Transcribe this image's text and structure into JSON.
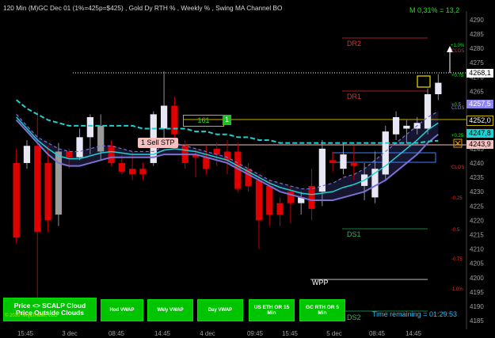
{
  "header": {
    "title": "120 Min  (M)GC Dec 01  (1%=425p=$425) , Gold Dy RTH % , Weekly % , Swing MA Channel BO",
    "momentum": "M 0,31% = 13,2"
  },
  "footer": {
    "time_remaining": "Time remaining = 01:29:53",
    "copyright": "© 2020 NinjaTrader, LLC"
  },
  "buttons": {
    "scalp_cloud": "Price <> SCALP Cloud",
    "price_outside": "Price Outside Clouds",
    "hod_vwap": "Hod VWAP",
    "wkly_vwap": "Wkly VWAP",
    "day_vwap": "Day VWAP",
    "us_eth": "US ETH OR 15 Min",
    "gc_rth": "GC RTH OR 5 Min"
  },
  "annotations": {
    "sell_stop": "1 Sell STP",
    "order_qty": "161",
    "order_count": "1",
    "dr2": "DR2",
    "dr1": "DR1",
    "ds1": "DS1",
    "ds2": "DS2",
    "wpp": "WPP",
    "clos": "CLOS",
    "pct_labels": [
      "+1.0%",
      "+0.75",
      "+0.5",
      "+0.25",
      "-0.25",
      "-0.5",
      "-0.75",
      "-1.0%"
    ]
  },
  "price_labels": {
    "last": "4268,1",
    "ma_upper": "4257,5",
    "order": "4252,0",
    "ma_mid": "4247,8",
    "sell_stop": "4243,9"
  },
  "colors": {
    "up_candle": "#e8e8f4",
    "down_candle": "#e00000",
    "up_grey": "#9a9a9a",
    "ma_cyan": "#20d0d0",
    "ma_purple": "#7a70d0",
    "band_fill": "#1a1a3a",
    "axis_text": "#a0a0a0",
    "button_green": "#00c400"
  },
  "chart_data": {
    "type": "candlestick",
    "title": "120 Min  (M)GC Dec 01  (1%=425p=$425) , Gold Dy RTH % , Weekly % , Swing MA Channel BO",
    "y_ticks": [
      4290,
      4285,
      4280,
      4275,
      4270,
      4265,
      4260,
      4255,
      4250,
      4245,
      4240,
      4235,
      4230,
      4225,
      4220,
      4215,
      4210,
      4205,
      4200,
      4195,
      4190,
      4185
    ],
    "ylim": [
      4182,
      4293
    ],
    "x_ticks": [
      "15:45",
      "3 dec",
      "08:45",
      "14:45",
      "4 dec",
      "09:45",
      "15:45",
      "5 dec",
      "08:45",
      "14:45"
    ],
    "candles": [
      {
        "o": 4240,
        "h": 4245,
        "l": 4212,
        "c": 4214
      },
      {
        "o": 4240,
        "h": 4248,
        "l": 4238,
        "c": 4246
      },
      {
        "o": 4246,
        "h": 4258,
        "l": 4192,
        "c": 4216
      },
      {
        "o": 4240,
        "h": 4246,
        "l": 4216,
        "c": 4220
      },
      {
        "o": 4222,
        "h": 4247,
        "l": 4218,
        "c": 4244
      },
      {
        "o": 4244,
        "h": 4245,
        "l": 4238,
        "c": 4242
      },
      {
        "o": 4242,
        "h": 4252,
        "l": 4241,
        "c": 4249
      },
      {
        "o": 4249,
        "h": 4257,
        "l": 4243,
        "c": 4256
      },
      {
        "o": 4244,
        "h": 4257,
        "l": 4241,
        "c": 4253
      },
      {
        "o": 4246,
        "h": 4248,
        "l": 4239,
        "c": 4240
      },
      {
        "o": 4240,
        "h": 4243,
        "l": 4236,
        "c": 4237
      },
      {
        "o": 4238,
        "h": 4244,
        "l": 4234,
        "c": 4236
      },
      {
        "o": 4238,
        "h": 4240,
        "l": 4234,
        "c": 4236
      },
      {
        "o": 4240,
        "h": 4258,
        "l": 4239,
        "c": 4257
      },
      {
        "o": 4252,
        "h": 4272,
        "l": 4246,
        "c": 4260
      },
      {
        "o": 4260,
        "h": 4263,
        "l": 4248,
        "c": 4250
      },
      {
        "o": 4246,
        "h": 4248,
        "l": 4238,
        "c": 4240
      },
      {
        "o": 4243,
        "h": 4245,
        "l": 4235,
        "c": 4242
      },
      {
        "o": 4242,
        "h": 4246,
        "l": 4236,
        "c": 4238
      },
      {
        "o": 4245,
        "h": 4247,
        "l": 4239,
        "c": 4243
      },
      {
        "o": 4244,
        "h": 4248,
        "l": 4236,
        "c": 4241
      },
      {
        "o": 4244,
        "h": 4247,
        "l": 4230,
        "c": 4231
      },
      {
        "o": 4238,
        "h": 4240,
        "l": 4230,
        "c": 4232
      },
      {
        "o": 4234,
        "h": 4236,
        "l": 4210,
        "c": 4220
      },
      {
        "o": 4232,
        "h": 4234,
        "l": 4218,
        "c": 4222
      },
      {
        "o": 4226,
        "h": 4228,
        "l": 4218,
        "c": 4222
      },
      {
        "o": 4230,
        "h": 4232,
        "l": 4219,
        "c": 4226
      },
      {
        "o": 4226,
        "h": 4230,
        "l": 4222,
        "c": 4228
      },
      {
        "o": 4232,
        "h": 4238,
        "l": 4220,
        "c": 4224
      },
      {
        "o": 4230,
        "h": 4248,
        "l": 4225,
        "c": 4245
      },
      {
        "o": 4241,
        "h": 4244,
        "l": 4237,
        "c": 4240
      },
      {
        "o": 4238,
        "h": 4247,
        "l": 4236,
        "c": 4243
      },
      {
        "o": 4240,
        "h": 4246,
        "l": 4234,
        "c": 4239
      },
      {
        "o": 4232,
        "h": 4240,
        "l": 4227,
        "c": 4236
      },
      {
        "o": 4228,
        "h": 4244,
        "l": 4226,
        "c": 4238
      },
      {
        "o": 4236,
        "h": 4253,
        "l": 4234,
        "c": 4251
      },
      {
        "o": 4250,
        "h": 4258,
        "l": 4248,
        "c": 4256
      },
      {
        "o": 4252,
        "h": 4255,
        "l": 4247,
        "c": 4253
      },
      {
        "o": 4252,
        "h": 4256,
        "l": 4250,
        "c": 4254
      },
      {
        "o": 4252,
        "h": 4266,
        "l": 4250,
        "c": 4264
      },
      {
        "o": 4264,
        "h": 4271,
        "l": 4262,
        "c": 4268
      }
    ],
    "ma_cyan": [
      4262,
      4259,
      4257,
      4255,
      4254,
      4253,
      4253,
      4253,
      4253,
      4253,
      4253,
      4253,
      4252,
      4252,
      4252,
      4252,
      4252,
      4251,
      4251,
      4250,
      4250,
      4249,
      4249,
      4248,
      4248,
      4247,
      4247,
      4247,
      4247,
      4247,
      4247,
      4247,
      4247,
      4247,
      4247,
      4247,
      4247,
      4247,
      4247,
      4247.5,
      4247.8
    ],
    "ma_purple": [
      4255,
      4251,
      4247,
      4243,
      4240,
      4239,
      4239,
      4240,
      4241,
      4242,
      4242,
      4242,
      4242,
      4242,
      4243,
      4243,
      4243,
      4243,
      4242,
      4241,
      4240,
      4238,
      4236,
      4234,
      4232,
      4230,
      4229,
      4228,
      4227,
      4227,
      4227,
      4228,
      4229,
      4230,
      4232,
      4234,
      4237,
      4240,
      4243,
      4247,
      4250
    ],
    "cloud_top": [
      4257,
      4253,
      4249,
      4247,
      4245,
      4244,
      4244,
      4245,
      4246,
      4246,
      4245,
      4244,
      4244,
      4244,
      4246,
      4247,
      4246,
      4245,
      4244,
      4243,
      4242,
      4240,
      4238,
      4236,
      4234,
      4233,
      4232,
      4231,
      4231,
      4232,
      4233,
      4235,
      4236,
      4238,
      4241,
      4244,
      4247,
      4250,
      4253,
      4256,
      4258
    ]
  }
}
